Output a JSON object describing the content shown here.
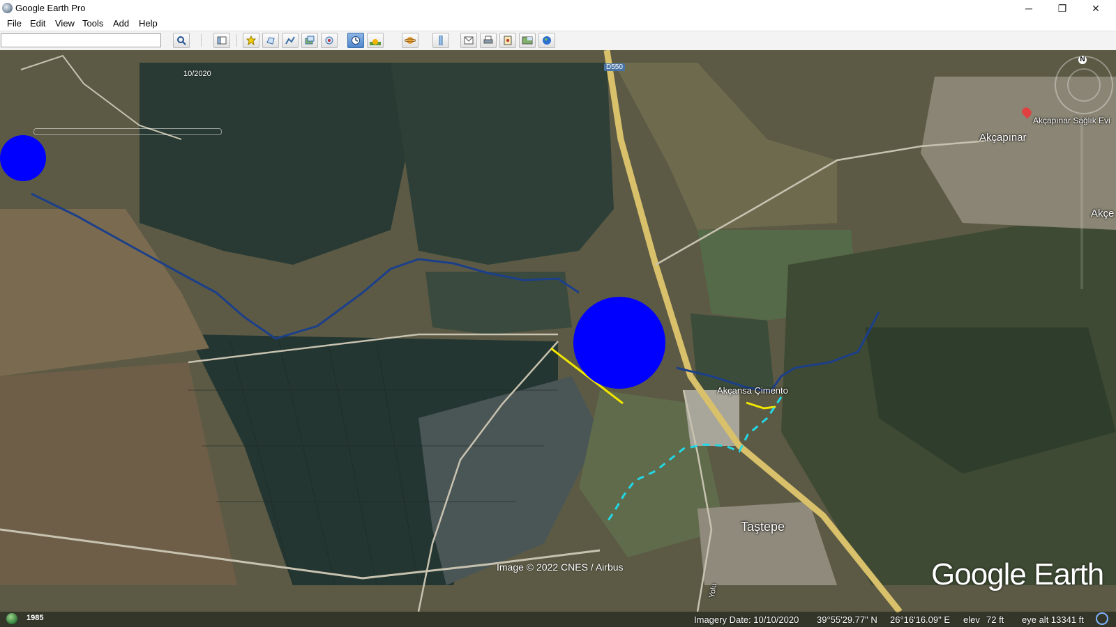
{
  "window": {
    "title": "Google Earth Pro",
    "minimize_glyph": "─",
    "restore_glyph": "❐",
    "close_glyph": "✕"
  },
  "menu": {
    "file": "File",
    "edit": "Edit",
    "view": "View",
    "tools": "Tools",
    "add": "Add",
    "help": "Help"
  },
  "toolbar": {
    "search_value": "",
    "buttons": [
      "search-icon",
      "sidebar-icon",
      "placemark-icon",
      "polygon-icon",
      "path-icon",
      "image-overlay-icon",
      "record-tour-icon",
      "historical-imagery-icon",
      "sunlight-icon",
      "planets-icon",
      "ruler-icon",
      "email-icon",
      "print-icon",
      "save-image-icon",
      "view-in-maps-icon",
      "earth-icon"
    ]
  },
  "map": {
    "time_slider_date": "10/2020",
    "road_label": "D550",
    "place_labels": {
      "akcapinar_health": "Akçapınar Sağlık Evi",
      "akcapinar": "Akçapınar",
      "akce": "Akçe",
      "akcansa": "Akçansa Çimento",
      "tastepe": "Taştepe",
      "road_side": "Yolu"
    },
    "copyright": "Image © 2022 CNES / Airbus",
    "logo": "Google Earth",
    "compass_n": "N",
    "overlay_colors": {
      "circles": "#0000ff",
      "river": "#1c3f8a",
      "yellow_line": "#f2e600",
      "cyan_dash": "#22d8e6"
    }
  },
  "status": {
    "year": "1985",
    "imagery_date": "Imagery Date: 10/10/2020",
    "lat": "39°55'29.77\" N",
    "lon": "26°16'16.09\" E",
    "elev_label": "elev",
    "elev": "72 ft",
    "eye_alt": "eye alt  13341 ft"
  }
}
